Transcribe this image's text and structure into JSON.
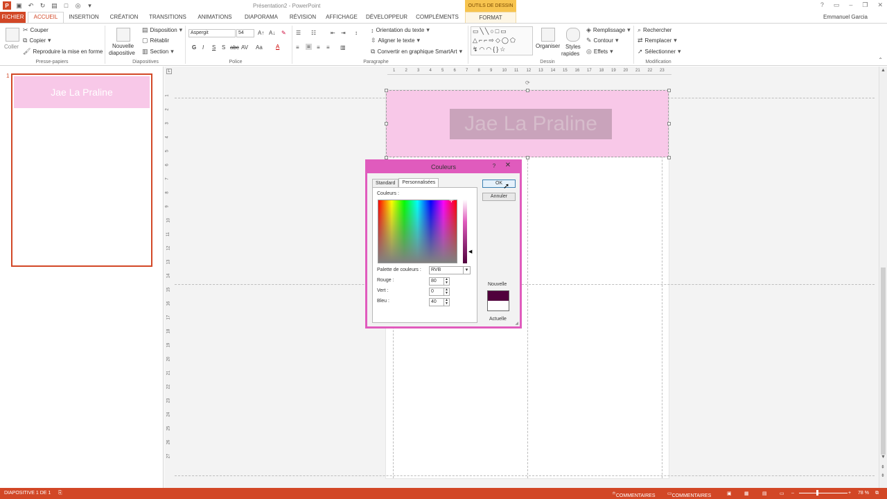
{
  "app": {
    "window_title": "Présentation2 - PowerPoint",
    "user": "Emmanuel Garcia",
    "contextual_tab_group": "OUTILS DE DESSIN"
  },
  "quick_access": [
    "save-icon",
    "undo-icon",
    "redo-icon",
    "start-icon",
    "new-icon",
    "print-icon"
  ],
  "ribbon": {
    "tabs": [
      {
        "label": "FICHIER"
      },
      {
        "label": "ACCUEIL"
      },
      {
        "label": "INSERTION"
      },
      {
        "label": "CRÉATION"
      },
      {
        "label": "TRANSITIONS"
      },
      {
        "label": "ANIMATIONS"
      },
      {
        "label": "DIAPORAMA"
      },
      {
        "label": "RÉVISION"
      },
      {
        "label": "AFFICHAGE"
      },
      {
        "label": "DÉVELOPPEUR"
      },
      {
        "label": "COMPLÉMENTS"
      },
      {
        "label": "FORMAT"
      }
    ],
    "active_tab": "ACCUEIL",
    "groups": {
      "clipboard": {
        "label": "Presse-papiers",
        "paste": "Coller",
        "cut": "Couper",
        "copy": "Copier",
        "format_painter": "Reproduire la mise en forme"
      },
      "slides": {
        "label": "Diapositives",
        "new_slide_line1": "Nouvelle",
        "new_slide_line2": "diapositive",
        "layout": "Disposition",
        "reset": "Rétablir",
        "section": "Section"
      },
      "font": {
        "label": "Police",
        "font_name": "Aspergit",
        "font_size": "54",
        "bold": "G",
        "italic": "I",
        "underline": "S",
        "shadow": "S",
        "strike": "abc",
        "spacing": "AV",
        "case": "Aa",
        "color": "A"
      },
      "paragraph": {
        "label": "Paragraphe",
        "text_direction": "Orientation du texte",
        "align_text": "Aligner le texte",
        "smartart": "Convertir en graphique SmartArt"
      },
      "drawing": {
        "label": "Dessin",
        "arrange": "Organiser",
        "quick_styles_line1": "Styles",
        "quick_styles_line2": "rapides",
        "fill": "Remplissage",
        "outline": "Contour",
        "effects": "Effets"
      },
      "editing": {
        "label": "Modification",
        "find": "Rechercher",
        "replace": "Remplacer",
        "select": "Sélectionner"
      }
    }
  },
  "thumbnails": {
    "slide_number": "1",
    "title_text": "Jae La Praline"
  },
  "slide": {
    "title_text": "Jae La Praline",
    "banner_color": "#f8c8e8"
  },
  "ruler": {
    "h_ticks": [
      "1",
      "2",
      "3",
      "4",
      "5",
      "6",
      "7",
      "8",
      "9",
      "10",
      "11",
      "12",
      "13",
      "14",
      "15",
      "16",
      "17",
      "18",
      "19",
      "20",
      "21",
      "22",
      "23"
    ],
    "v_ticks": [
      "1",
      "2",
      "3",
      "4",
      "5",
      "6",
      "7",
      "8",
      "9",
      "10",
      "11",
      "12",
      "13",
      "14",
      "15",
      "16",
      "17",
      "18",
      "19",
      "20",
      "21",
      "22",
      "23",
      "24",
      "25",
      "26",
      "27"
    ]
  },
  "dialog": {
    "title": "Couleurs",
    "help": "?",
    "close": "✕",
    "tabs": [
      "Standard",
      "Personnalisées"
    ],
    "active_tab": "Personnalisées",
    "colors_label": "Couleurs :",
    "palette_label": "Palette de couleurs :",
    "palette_value": "RVB",
    "red_label": "Rouge :",
    "red_value": "80",
    "green_label": "Vert :",
    "green_value": "0",
    "blue_label": "Bleu :",
    "blue_value": "40",
    "ok": "OK",
    "cancel": "Annuler",
    "new_label": "Nouvelle",
    "current_label": "Actuelle",
    "new_color": "#50003c",
    "current_color": "#ffffff"
  },
  "status_bar": {
    "slide_info": "DIAPOSITIVE 1 DE 1",
    "notes": "COMMENTAIRES",
    "comments": "COMMENTAIRES",
    "zoom": "78 %"
  }
}
